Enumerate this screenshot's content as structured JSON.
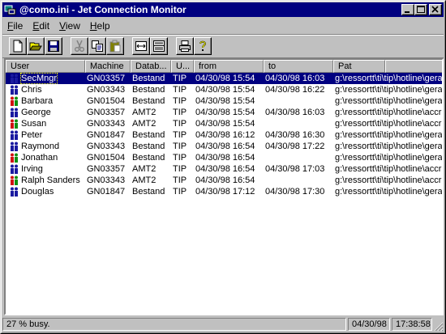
{
  "window": {
    "title": "@como.ini - Jet Connection Monitor",
    "controls": {
      "minimize": "minimize",
      "maximize": "maximize",
      "close": "close"
    }
  },
  "menubar": {
    "items": [
      {
        "label": "File",
        "accel": "F",
        "rest": "ile"
      },
      {
        "label": "Edit",
        "accel": "E",
        "rest": "dit"
      },
      {
        "label": "View",
        "accel": "V",
        "rest": "iew"
      },
      {
        "label": "Help",
        "accel": "H",
        "rest": "elp"
      }
    ]
  },
  "toolbar": {
    "buttons": [
      "new-file-icon",
      "open-folder-icon",
      "save-disk-icon",
      "cut-icon",
      "copy-icon",
      "paste-icon",
      "fit-width-icon",
      "split-view-icon",
      "print-icon",
      "help-icon"
    ]
  },
  "table": {
    "columns": [
      "User",
      "Machine",
      "Datab...",
      "U...",
      "from",
      "to",
      "Pat"
    ],
    "rows": [
      {
        "user": "SecMngr",
        "machine": "GN03357",
        "db": "Bestand",
        "u": "TIP",
        "from": "04/30/98 15:54",
        "to": "04/30/98 16:03",
        "path": "g:\\ressortt\\ti\\tip\\hotline\\gera",
        "icon": "blue",
        "selected": true
      },
      {
        "user": "Chris",
        "machine": "GN03343",
        "db": "Bestand",
        "u": "TIP",
        "from": "04/30/98 15:54",
        "to": "04/30/98 16:22",
        "path": "g:\\ressortt\\ti\\tip\\hotline\\gera",
        "icon": "blue"
      },
      {
        "user": "Barbara",
        "machine": "GN01504",
        "db": "Bestand",
        "u": "TIP",
        "from": "04/30/98 15:54",
        "to": "",
        "path": "g:\\ressortt\\ti\\tip\\hotline\\gera",
        "icon": "mixed"
      },
      {
        "user": "George",
        "machine": "GN03357",
        "db": "AMT2",
        "u": "TIP",
        "from": "04/30/98 15:54",
        "to": "04/30/98 16:03",
        "path": "g:\\ressortt\\ti\\tip\\hotline\\accr",
        "icon": "blue"
      },
      {
        "user": "Susan",
        "machine": "GN03343",
        "db": "AMT2",
        "u": "TIP",
        "from": "04/30/98 15:54",
        "to": "",
        "path": "g:\\ressortt\\ti\\tip\\hotline\\accr",
        "icon": "mixed"
      },
      {
        "user": "Peter",
        "machine": "GN01847",
        "db": "Bestand",
        "u": "TIP",
        "from": "04/30/98 16:12",
        "to": "04/30/98 16:30",
        "path": "g:\\ressortt\\ti\\tip\\hotline\\gera",
        "icon": "blue"
      },
      {
        "user": "Raymond",
        "machine": "GN03343",
        "db": "Bestand",
        "u": "TIP",
        "from": "04/30/98 16:54",
        "to": "04/30/98 17:22",
        "path": "g:\\ressortt\\ti\\tip\\hotline\\gera",
        "icon": "blue"
      },
      {
        "user": "Jonathan",
        "machine": "GN01504",
        "db": "Bestand",
        "u": "TIP",
        "from": "04/30/98 16:54",
        "to": "",
        "path": "g:\\ressortt\\ti\\tip\\hotline\\gera",
        "icon": "mixed"
      },
      {
        "user": "Irving",
        "machine": "GN03357",
        "db": "AMT2",
        "u": "TIP",
        "from": "04/30/98 16:54",
        "to": "04/30/98 17:03",
        "path": "g:\\ressortt\\ti\\tip\\hotline\\accr",
        "icon": "blue"
      },
      {
        "user": "Ralph Sanders",
        "machine": "GN03343",
        "db": "AMT2",
        "u": "TIP",
        "from": "04/30/98 16:54",
        "to": "",
        "path": "g:\\ressortt\\ti\\tip\\hotline\\accr",
        "icon": "mixed"
      },
      {
        "user": "Douglas",
        "machine": "GN01847",
        "db": "Bestand",
        "u": "TIP",
        "from": "04/30/98 17:12",
        "to": "04/30/98 17:30",
        "path": "g:\\ressortt\\ti\\tip\\hotline\\gera",
        "icon": "blue"
      }
    ]
  },
  "statusbar": {
    "busy": "27 % busy.",
    "date": "04/30/98",
    "time": "17:38:58"
  },
  "colors": {
    "titlebar": "#000080",
    "selection": "#000080",
    "face": "#c0c0c0",
    "icon_blue": "#1a1aa0",
    "icon_red": "#d01010",
    "icon_green": "#109010"
  }
}
